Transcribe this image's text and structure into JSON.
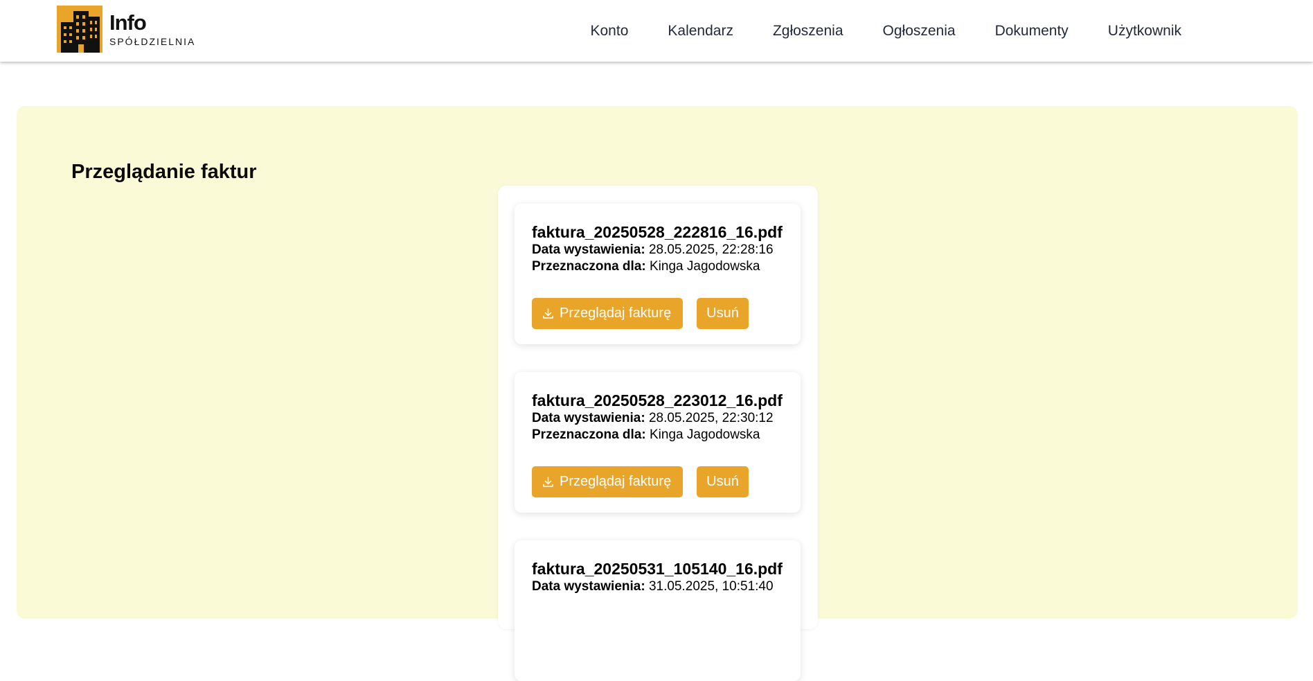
{
  "app": {
    "logo_title": "Info",
    "logo_subtitle": "SPÓŁDZIELNIA",
    "brand_color": "#e8a52a"
  },
  "nav": {
    "items": [
      {
        "label": "Konto"
      },
      {
        "label": "Kalendarz"
      },
      {
        "label": "Zgłoszenia"
      },
      {
        "label": "Ogłoszenia"
      },
      {
        "label": "Dokumenty"
      },
      {
        "label": "Użytkownik"
      }
    ]
  },
  "page": {
    "title": "Przeglądanie faktur",
    "panel_color": "#fafad7"
  },
  "invoices": {
    "issue_label": "Data wystawienia:",
    "recipient_label": "Przeznaczona dla:",
    "view_label": "Przeglądaj fakturę",
    "delete_label": "Usuń",
    "view_icon": "download-icon",
    "items": [
      {
        "filename": "faktura_20250528_222816_16.pdf",
        "issued": "28.05.2025, 22:28:16",
        "recipient": "Kinga Jagodowska"
      },
      {
        "filename": "faktura_20250528_223012_16.pdf",
        "issued": "28.05.2025, 22:30:12",
        "recipient": "Kinga Jagodowska"
      },
      {
        "filename": "faktura_20250531_105140_16.pdf",
        "issued": "31.05.2025, 10:51:40",
        "recipient": ""
      }
    ]
  }
}
